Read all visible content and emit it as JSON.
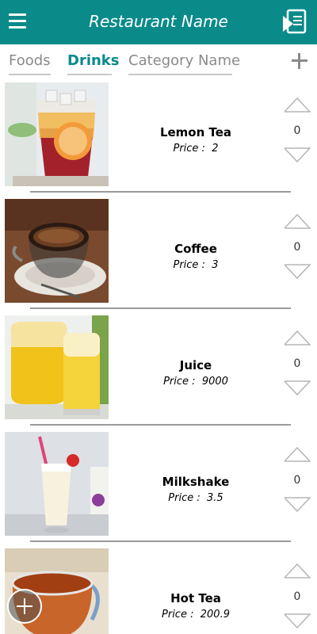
{
  "header": {
    "title": "Restaurant Name",
    "menu_icon": "hamburger-menu-icon",
    "order_icon": "order-list-icon",
    "color": "#0b8a8a"
  },
  "tabs": [
    {
      "label": "Foods",
      "active": false
    },
    {
      "label": "Drinks",
      "active": true
    },
    {
      "label": "Category Name",
      "active": false
    }
  ],
  "add_category_icon": "plus-icon",
  "items": [
    {
      "name": "Lemon Tea",
      "price_label": "Price :",
      "price": "2",
      "quantity": "0"
    },
    {
      "name": "Coffee",
      "price_label": "Price :",
      "price": "3",
      "quantity": "0"
    },
    {
      "name": "Juice",
      "price_label": "Price :",
      "price": "9000",
      "quantity": "0"
    },
    {
      "name": "Milkshake",
      "price_label": "Price :",
      "price": "3.5",
      "quantity": "0"
    },
    {
      "name": "Hot Tea",
      "price_label": "Price :",
      "price": "200.9",
      "quantity": "0"
    }
  ],
  "fab_icon": "add-circle-icon"
}
